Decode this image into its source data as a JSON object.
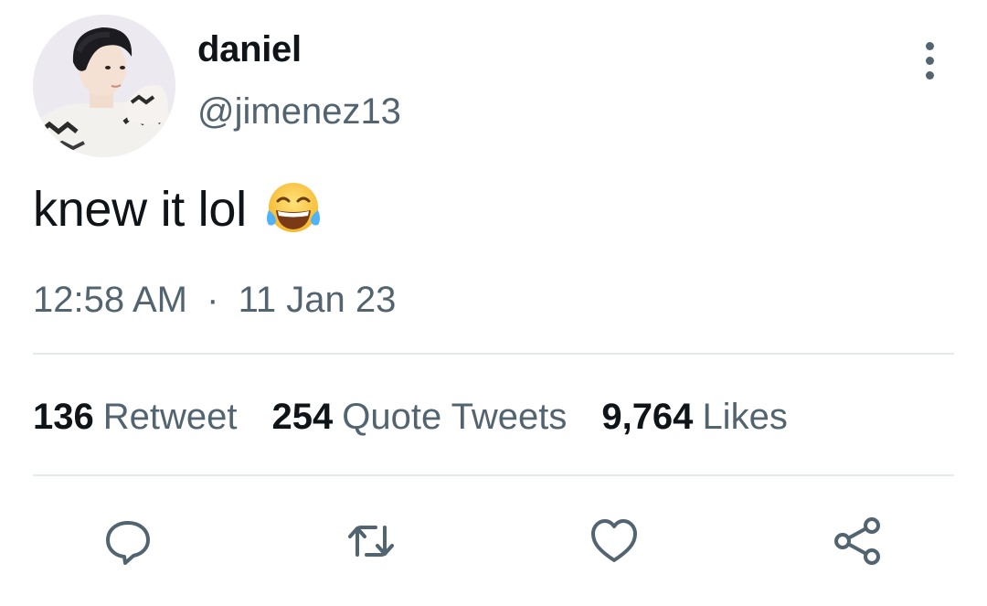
{
  "author": {
    "display_name": "daniel",
    "handle": "@jimenez13",
    "avatar": "avatar-photo"
  },
  "tweet": {
    "text": "knew it lol",
    "emoji": "face-with-tears-of-joy"
  },
  "meta": {
    "time": "12:58 AM",
    "separator": "·",
    "date": "11 Jan 23"
  },
  "stats": [
    {
      "count": "136",
      "label": "Retweet"
    },
    {
      "count": "254",
      "label": "Quote Tweets"
    },
    {
      "count": "9,764",
      "label": "Likes"
    }
  ],
  "actions": {
    "reply_icon": "reply-icon",
    "retweet_icon": "retweet-icon",
    "like_icon": "heart-icon",
    "share_icon": "share-icon",
    "more_icon": "more-vertical-icon"
  },
  "colors": {
    "text_primary": "#0f1419",
    "text_secondary": "#536471",
    "divider": "#e6e9ec"
  }
}
